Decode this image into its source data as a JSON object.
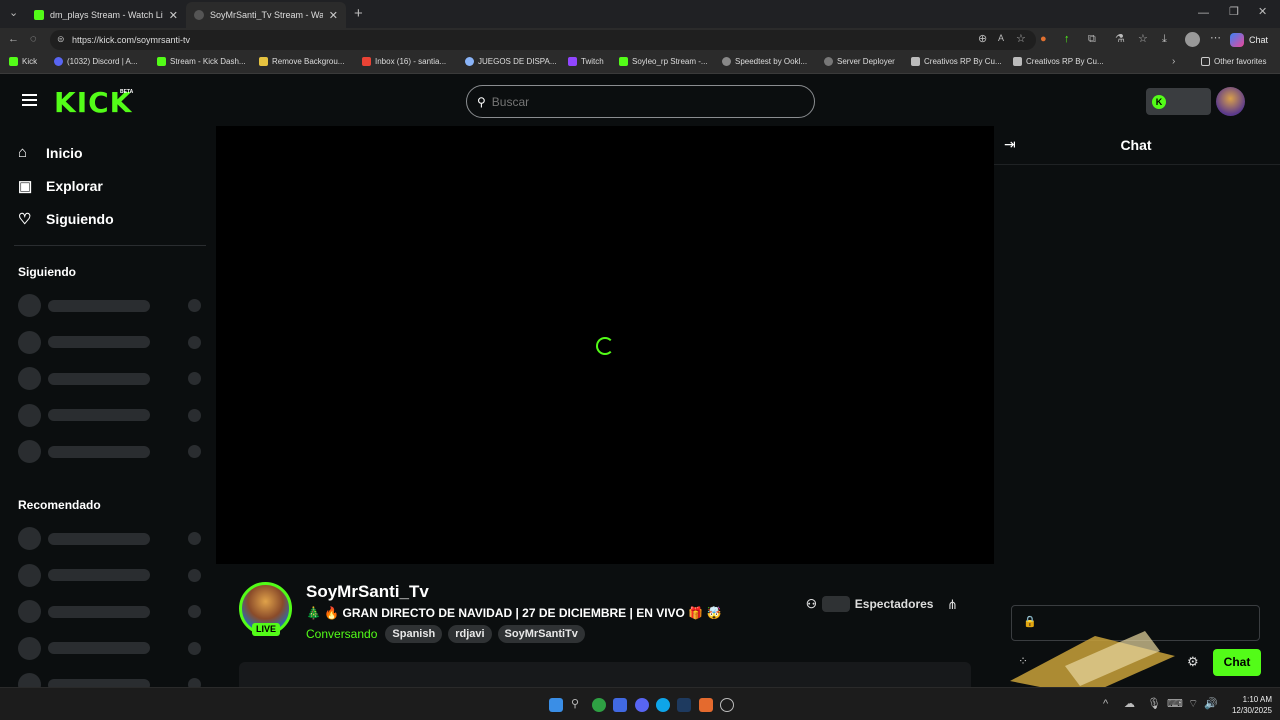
{
  "browser": {
    "tabs": [
      {
        "title": "dm_plays Stream - Watch Live on Kick"
      },
      {
        "title": "SoyMrSanti_Tv Stream - Watch Live on Kick"
      }
    ],
    "url": "https://kick.com/soymrsanti-tv",
    "copilot_label": "Chat",
    "bookmarks": [
      "Kick",
      "(1032) Discord | A...",
      "Stream - Kick Dash...",
      "Remove Backgrou...",
      "Inbox (16) - santia...",
      "JUEGOS DE DISPA...",
      "Twitch",
      "Soyleo_rp Stream -...",
      "Speedtest by Ookl...",
      "Server Deployer",
      "Creativos RP By Cu...",
      "Creativos RP By Cu..."
    ],
    "other_favorites": "Other favorites"
  },
  "header": {
    "logo": "KICK",
    "beta": "BETA",
    "search_placeholder": "Buscar"
  },
  "sidebar": {
    "nav": [
      {
        "label": "Inicio",
        "icon": "home-icon"
      },
      {
        "label": "Explorar",
        "icon": "browse-icon"
      },
      {
        "label": "Siguiendo",
        "icon": "heart-icon"
      }
    ],
    "following_title": "Siguiendo",
    "recommended_title": "Recomendado"
  },
  "stream": {
    "channel": "SoyMrSanti_Tv",
    "live_badge": "LIVE",
    "title": "🎄 🔥 GRAN DIRECTO DE NAVIDAD | 27 DE DICIEMBRE | EN VIVO 🎁 🤯",
    "category": "Conversando",
    "tags": [
      "Spanish",
      "rdjavi",
      "SoyMrSantiTv"
    ],
    "viewers_label": "Espectadores"
  },
  "chat": {
    "title": "Chat",
    "send_label": "Chat"
  },
  "taskbar": {
    "time": "1:10 AM",
    "date": "12/30/2025"
  },
  "colors": {
    "accent": "#53fc18",
    "background": "#0b0e0f",
    "skeleton": "#2a2d30"
  }
}
